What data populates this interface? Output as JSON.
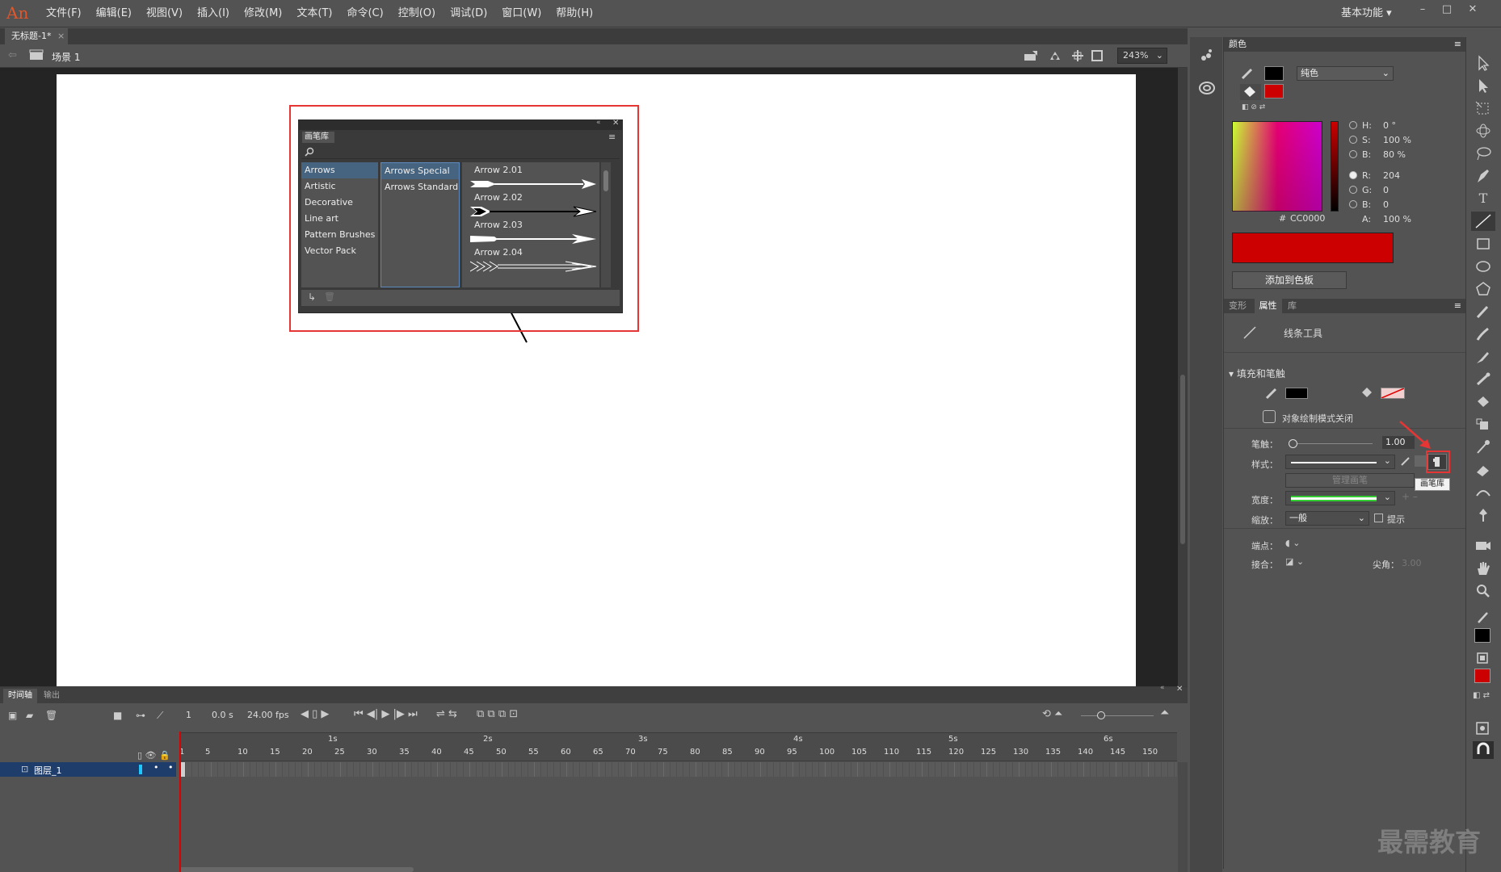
{
  "app": {
    "logo": "An"
  },
  "menu": [
    "文件(F)",
    "编辑(E)",
    "视图(V)",
    "插入(I)",
    "修改(M)",
    "文本(T)",
    "命令(C)",
    "控制(O)",
    "调试(D)",
    "窗口(W)",
    "帮助(H)"
  ],
  "workspace": "基本功能",
  "doc_tab": {
    "title": "无标题-1*",
    "close": "×"
  },
  "scene": {
    "label": "场景 1",
    "zoom": "243%"
  },
  "brush_library": {
    "tab": "画笔库",
    "categories": [
      "Arrows",
      "Artistic",
      "Decorative",
      "Line art",
      "Pattern Brushes",
      "Vector Pack"
    ],
    "selected_category": "Arrows",
    "subcategories": [
      "Arrows Special",
      "Arrows Standard"
    ],
    "selected_subcategory": "Arrows Special",
    "brushes": [
      "Arrow 2.01",
      "Arrow 2.02",
      "Arrow 2.03",
      "Arrow 2.04"
    ]
  },
  "color_panel": {
    "tab": "颜色",
    "type": "纯色",
    "H": "0 °",
    "S": "100 %",
    "B": "80 %",
    "R": "204",
    "G": "0",
    "Bv": "0",
    "hex": "CC0000",
    "A": "100 %",
    "hash": "#",
    "add_swatch": "添加到色板",
    "color": "#cc0000"
  },
  "properties": {
    "tabs": [
      "变形",
      "属性",
      "库"
    ],
    "active_tab": "属性",
    "tool_name": "线条工具",
    "section": "填充和笔触",
    "object_draw": "对象绘制模式关闭",
    "stroke_label": "笔触：",
    "stroke_value": "1.00",
    "style_label": "样式：",
    "manage_brush": "管理画笔",
    "tooltip": "画笔库",
    "width_label": "宽度：",
    "scale_label": "缩放：",
    "scale_value": "一般",
    "hint_label": "提示",
    "cap_label": "端点：",
    "join_label": "接合：",
    "miter_label": "尖角：",
    "miter_value": "3.00"
  },
  "timeline": {
    "tabs": [
      "时间轴",
      "输出"
    ],
    "frame": "1",
    "time": "0.0 s",
    "fps": "24.00 fps",
    "seconds": [
      "1s",
      "2s",
      "3s",
      "4s",
      "5s",
      "6s"
    ],
    "frame_numbers": [
      "1",
      "5",
      "10",
      "15",
      "20",
      "25",
      "30",
      "35",
      "40",
      "45",
      "50",
      "55",
      "60",
      "65",
      "70",
      "75",
      "80",
      "85",
      "90",
      "95",
      "100",
      "105",
      "110",
      "115",
      "120",
      "125",
      "130",
      "135",
      "140",
      "145",
      "150"
    ],
    "layer": "图层_1"
  },
  "watermark": "最需教育"
}
